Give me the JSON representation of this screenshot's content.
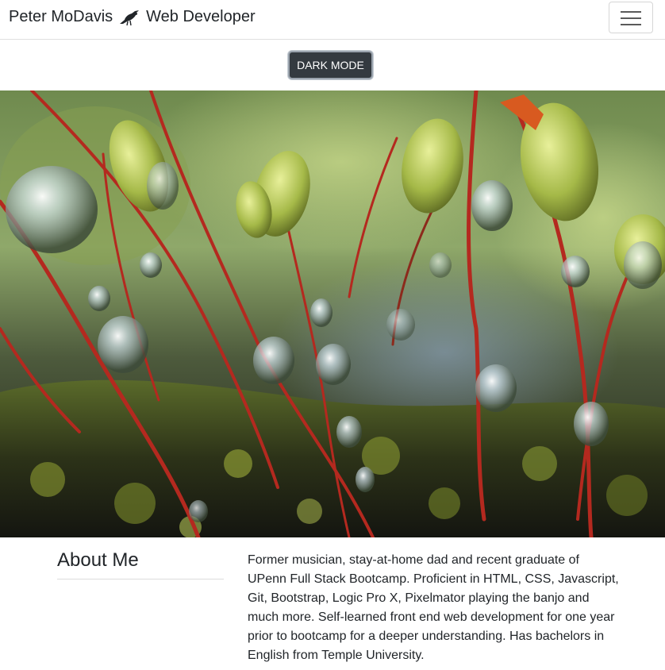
{
  "navbar": {
    "brand_name": "Peter MoDavis",
    "brand_title": "Web Developer",
    "brand_icon": "crow-icon",
    "toggler_icon": "hamburger-menu-icon"
  },
  "theme_toggle": {
    "label": "DARK MODE"
  },
  "hero": {
    "image": "moss-sporophytes-with-water-droplets-photo"
  },
  "about": {
    "heading": "About Me",
    "text": "Former musician, stay-at-home dad and recent graduate of UPenn Full Stack Bootcamp. Proficient in HTML, CSS, Javascript, Git, Bootstrap, Logic Pro X, Pixelmator playing the banjo and much more. Self-learned front end web development for one year prior to bootcamp for a deeper understanding. Has bachelors in English from Temple University."
  },
  "colors": {
    "button_bg": "#343a40",
    "text": "#212529"
  }
}
